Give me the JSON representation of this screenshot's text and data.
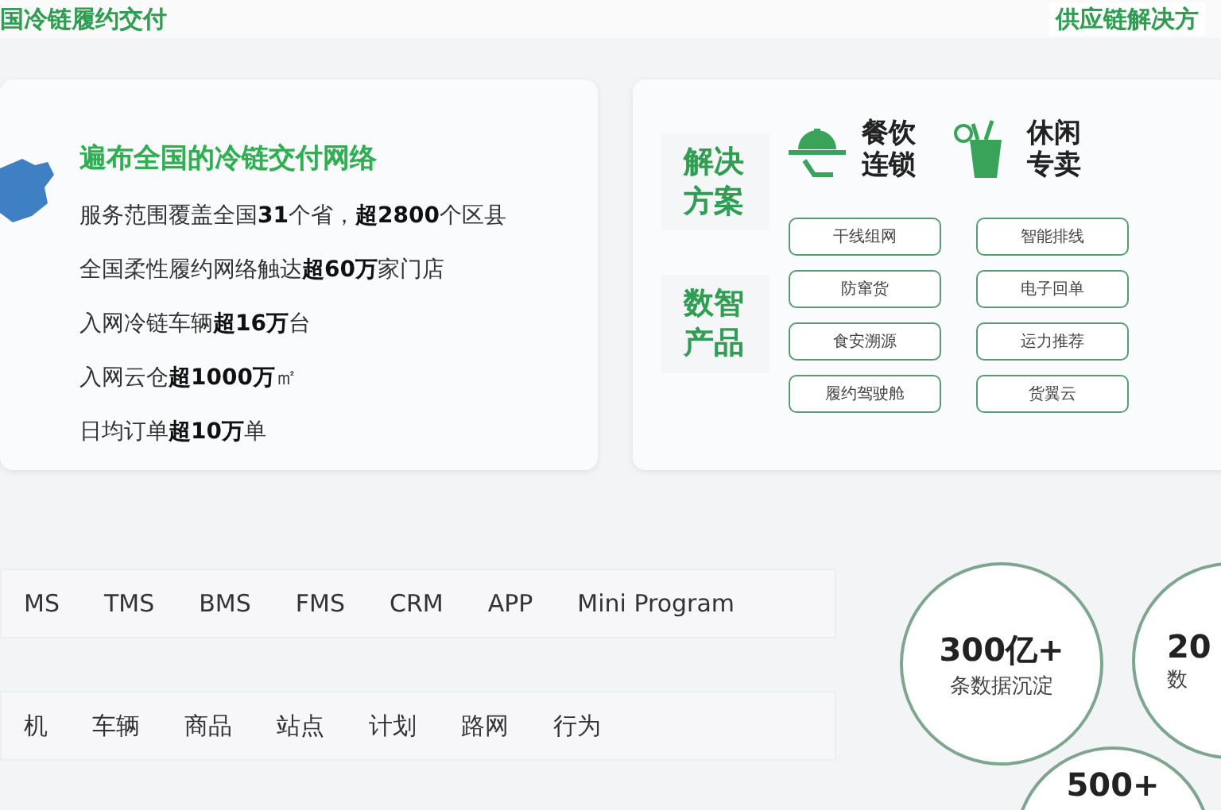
{
  "headings": [
    "国冷链履约交付",
    "供应链解决方"
  ],
  "network": {
    "title": "遍布全国的冷链交付网络",
    "lines": [
      "服务范围覆盖全国**31**个省，**超2800**个区县",
      "全国柔性履约网络触达**超60万**家门店",
      "入网冷链车辆**超16万**台",
      "入网云仓**超1000万**㎡",
      "日均订单**超10万**单"
    ]
  },
  "solutions": {
    "labels": [
      "解决方案",
      "数智产品"
    ],
    "industries": [
      {
        "kind": "cloche",
        "name": "餐饮连锁"
      },
      {
        "kind": "drink",
        "name": "休闲专卖"
      }
    ],
    "products": [
      "干线组网",
      "智能排线",
      "防窜货",
      "电子回单",
      "食安溯源",
      "运力推荐",
      "履约驾驶舱",
      "货翼云"
    ]
  },
  "systems": [
    "MS",
    "TMS",
    "BMS",
    "FMS",
    "CRM",
    "APP",
    "Mini Program"
  ],
  "data_types": [
    "机",
    "车辆",
    "商品",
    "站点",
    "计划",
    "路网",
    "行为"
  ],
  "stats": [
    {
      "value": "300亿+",
      "label": "条数据沉淀"
    },
    {
      "value": "20",
      "label": "数"
    },
    {
      "value": "500+"
    }
  ]
}
